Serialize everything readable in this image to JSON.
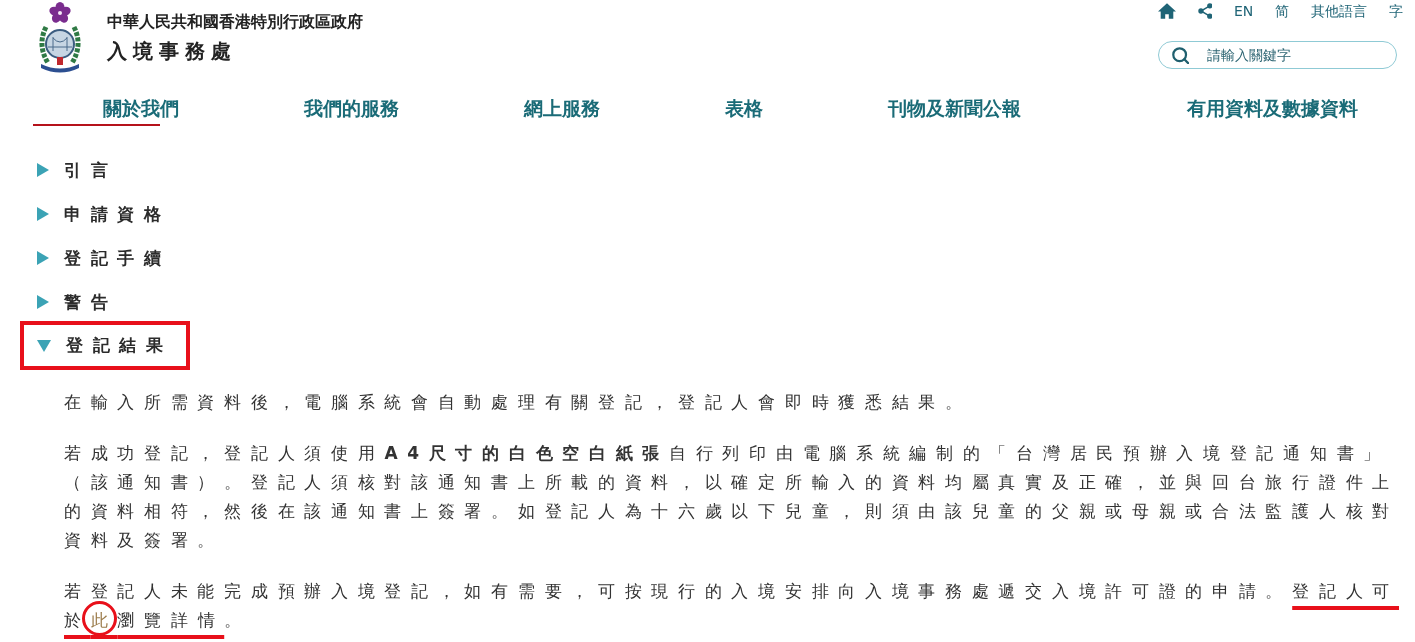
{
  "header": {
    "agency_parent": "中華人民共和國香港特別行政區政府",
    "agency_name": "入境事務處"
  },
  "utility_links": [
    {
      "kind": "home"
    },
    {
      "kind": "share"
    },
    {
      "kind": "text",
      "label": "EN"
    },
    {
      "kind": "text",
      "label": "简"
    },
    {
      "kind": "text",
      "label": "其他語言"
    },
    {
      "kind": "text",
      "label": "字"
    }
  ],
  "search": {
    "placeholder": "請輸入關鍵字"
  },
  "nav": [
    {
      "label": "關於我們",
      "selected": true
    },
    {
      "label": "我們的服務",
      "selected": false
    },
    {
      "label": "網上服務",
      "selected": false
    },
    {
      "label": "表格",
      "selected": false
    },
    {
      "label": "刊物及新聞公報",
      "selected": false
    },
    {
      "label": "有用資料及數據資料",
      "selected": false
    }
  ],
  "sections": [
    {
      "title": "引言",
      "expanded": false,
      "pen_box": false
    },
    {
      "title": "申請資格",
      "expanded": false,
      "pen_box": false
    },
    {
      "title": "登記手續",
      "expanded": false,
      "pen_box": false
    },
    {
      "title": "警告",
      "expanded": false,
      "pen_box": false
    },
    {
      "title": "登記結果",
      "expanded": true,
      "pen_box": true,
      "paragraphs": [
        {
          "segments": [
            {
              "kind": "text",
              "text": "在輸入所需資料後，電腦系統會自動處理有關登記，登記人會即時獲悉結果。"
            }
          ]
        },
        {
          "segments": [
            {
              "kind": "text",
              "text": "若成功登記，登記人須使用**A4尺寸的白色空白紙張**自行列印由電腦系統編制的「台灣居民預辦入境登記通知書」（該通知書）。登記人須核對該通知書上所載的資料，以確定所輸入的資料均屬真實及正確，並與回台旅行證件上的資料相符，然後在該通知書上簽署。如登記人為十六歲以下兒童，則須由該兒童的父親或母親或合法監護人核對資料及簽署。"
            }
          ]
        },
        {
          "segments": [
            {
              "kind": "text",
              "text": "若登記人未能完成預辦入境登記，如有需要，可按現行的入境安排向入境事務處遞交入境許可證的申請。"
            },
            {
              "kind": "underlined",
              "text": "登記人可"
            },
            {
              "kind": "underlined",
              "text": "於"
            },
            {
              "kind": "link",
              "text": "此",
              "underlined": true,
              "circled": true
            },
            {
              "kind": "underlined",
              "text": "瀏覽詳情"
            },
            {
              "kind": "text",
              "text": "。"
            }
          ]
        }
      ]
    }
  ]
}
